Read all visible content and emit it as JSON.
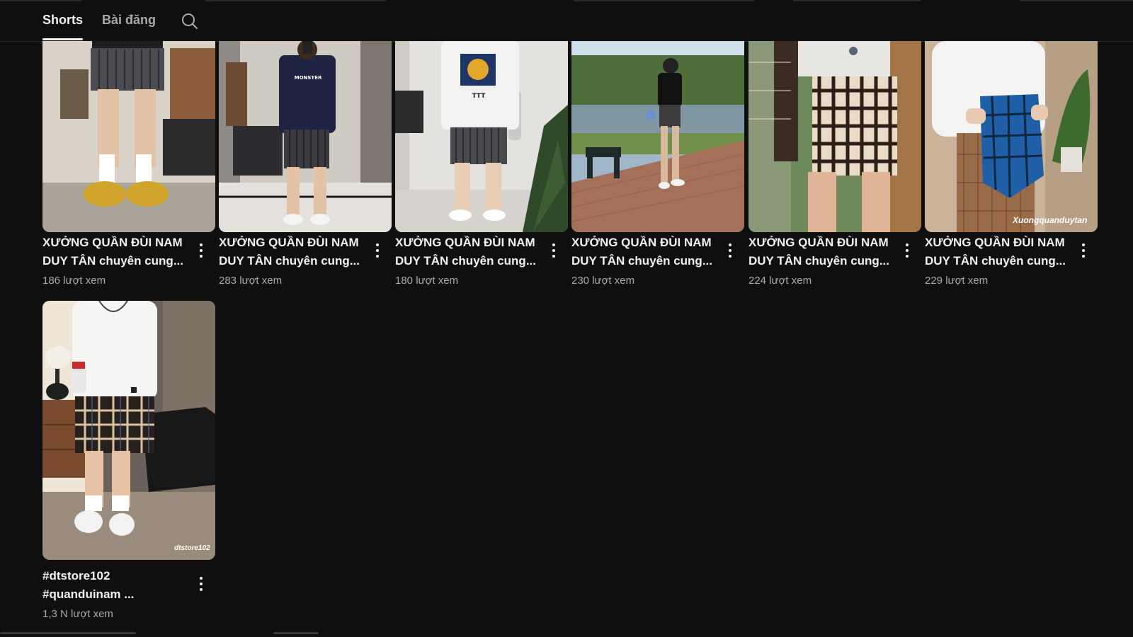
{
  "tabs": {
    "shorts": "Shorts",
    "posts": "Bài đăng",
    "search_icon": "search-icon"
  },
  "videos": [
    {
      "title_line1": "XƯỞNG QUẦN ĐÙI NAM",
      "title_line2": "DUY TÂN chuyên cung...",
      "views": "186 lượt xem"
    },
    {
      "title_line1": "XƯỞNG QUẦN ĐÙI NAM",
      "title_line2": "DUY TÂN chuyên cung...",
      "views": "283 lượt xem",
      "shirt_text": "MONSTER"
    },
    {
      "title_line1": "XƯỞNG QUẦN ĐÙI NAM",
      "title_line2": "DUY TÂN chuyên cung...",
      "views": "180 lượt xem"
    },
    {
      "title_line1": "XƯỞNG QUẦN ĐÙI NAM",
      "title_line2": "DUY TÂN chuyên cung...",
      "views": "230 lượt xem"
    },
    {
      "title_line1": "XƯỞNG QUẦN ĐÙI NAM",
      "title_line2": "DUY TÂN chuyên cung...",
      "views": "224 lượt xem"
    },
    {
      "title_line1": "XƯỞNG QUẦN ĐÙI NAM",
      "title_line2": "DUY TÂN chuyên cung...",
      "views": "229 lượt xem",
      "watermark": "Xuongquanduytan"
    },
    {
      "title_line1": "#dtstore102",
      "title_line2": "#quanduinam ...",
      "views": "1,3 N lượt xem",
      "watermark": "dtstore102"
    }
  ],
  "colors": {
    "background": "#0f0f0f",
    "text_primary": "#f1f1f1",
    "text_secondary": "#aaaaaa"
  }
}
